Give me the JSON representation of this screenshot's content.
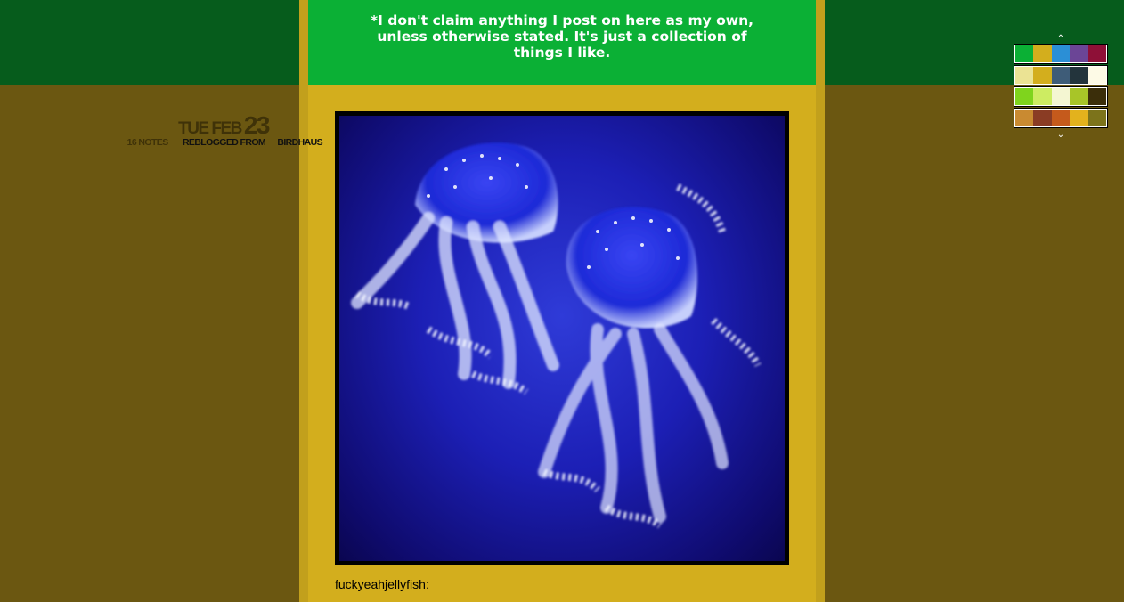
{
  "header": {
    "text": "*I don't claim anything I post on here as my own, unless otherwise stated. It's just a collection of things I like."
  },
  "post": {
    "date": {
      "dow_month": "TUE FEB",
      "day": "23"
    },
    "notes": "16 NOTES",
    "reblogged_from_label": "REBLOGGED FROM",
    "source": "BIRDHAUS",
    "image_subject": "jellyfish",
    "caption_link": "fuckyeahjellyfish",
    "caption_suffix": ":"
  },
  "palette": {
    "up_arrow": "⌃",
    "down_arrow": "⌄",
    "rows": [
      [
        "#0bb035",
        "#d3ae1d",
        "#2b8fd6",
        "#6b4596",
        "#8e1037"
      ],
      [
        "#ebe394",
        "#d3ae1d",
        "#3e5c78",
        "#23343c",
        "#fdfae6"
      ],
      [
        "#7fd41d",
        "#cdec62",
        "#f4f6d2",
        "#a8c528",
        "#3b2e0a"
      ],
      [
        "#c98a31",
        "#8a3c24",
        "#c55a1c",
        "#e3b21d",
        "#7c731b"
      ]
    ]
  },
  "colors": {
    "background": "#6b5711",
    "top_band": "#065c1c",
    "column": "#d3ae1d",
    "header_box": "#0bb035"
  }
}
